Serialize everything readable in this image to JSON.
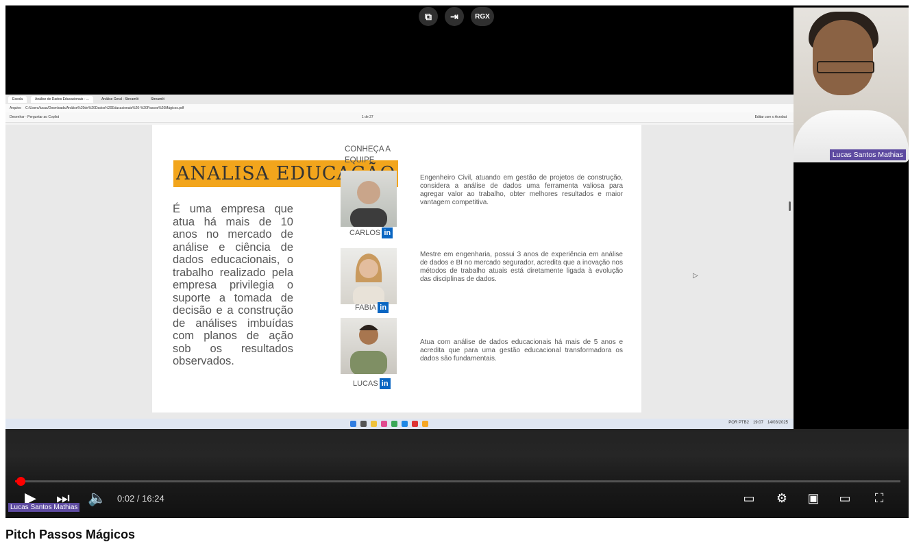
{
  "player": {
    "top_icons": [
      "⧉",
      "⇥",
      "RGX"
    ],
    "browser": {
      "profile": "Escola",
      "tabs": [
        "Análise de Dados Educacionais - ...",
        "Análise Geral - Streamlit",
        "Streamlit"
      ],
      "address": "C:/Users/lucas/Downloads/Análise%20de%20Dados%20Educacionais%20-%20Passos%20Mágicos.pdf",
      "address_prefix": "Arquivo",
      "pdf_toolbar_left": "Desenhar  ·  Perguntar ao Copilot",
      "page_current": "1",
      "page_total": "de 27",
      "pdf_toolbar_right": "Editar com o Acrobat"
    },
    "slide": {
      "heading": "ANALISA EDUCAÇÃO",
      "description": "É uma empresa que atua há mais de 10 anos no mercado de análise e ciência de dados educacionais, o trabalho realizado pela empresa privilegia o suporte a tomada de decisão e a construção de análises imbuídas com planos de ação sob os resultados observados.",
      "team_heading": "CONHEÇA A EQUIPE",
      "members": [
        {
          "name": "CARLOS",
          "bio": "Engenheiro Civil, atuando em gestão de projetos de construção, considera a análise de dados uma ferramenta valiosa para agregar valor ao trabalho, obter melhores resultados e maior vantagem competitiva."
        },
        {
          "name": "FABIA",
          "bio": "Mestre em engenharia, possui 3 anos de experiência em análise de dados e BI no mercado segurador, acredita que a inovação nos métodos de trabalho atuais está diretamente ligada à evolução das disciplinas de dados."
        },
        {
          "name": "LUCAS",
          "bio": "Atua com análise de dados educacionais há mais de 5 anos e acredita que para uma gestão educacional transformadora os dados são fundamentais."
        }
      ],
      "linkedin_label": "in"
    },
    "taskbar": {
      "lang": "POR PTB2",
      "time": "19:07",
      "date": "14/03/2025"
    },
    "webcam_name": "Lucas Santos Mathias",
    "controls": {
      "time": "0:02 / 16:24",
      "speaker_tag": "Lucas Santos Mathias",
      "progress_fraction": 0.002
    }
  },
  "video_title": "Pitch Passos Mágicos",
  "colors": {
    "progress": "#ff0000",
    "accent": "#f2a51c",
    "linkedin": "#0a66c2",
    "name_tag": "#5d4aa0"
  }
}
